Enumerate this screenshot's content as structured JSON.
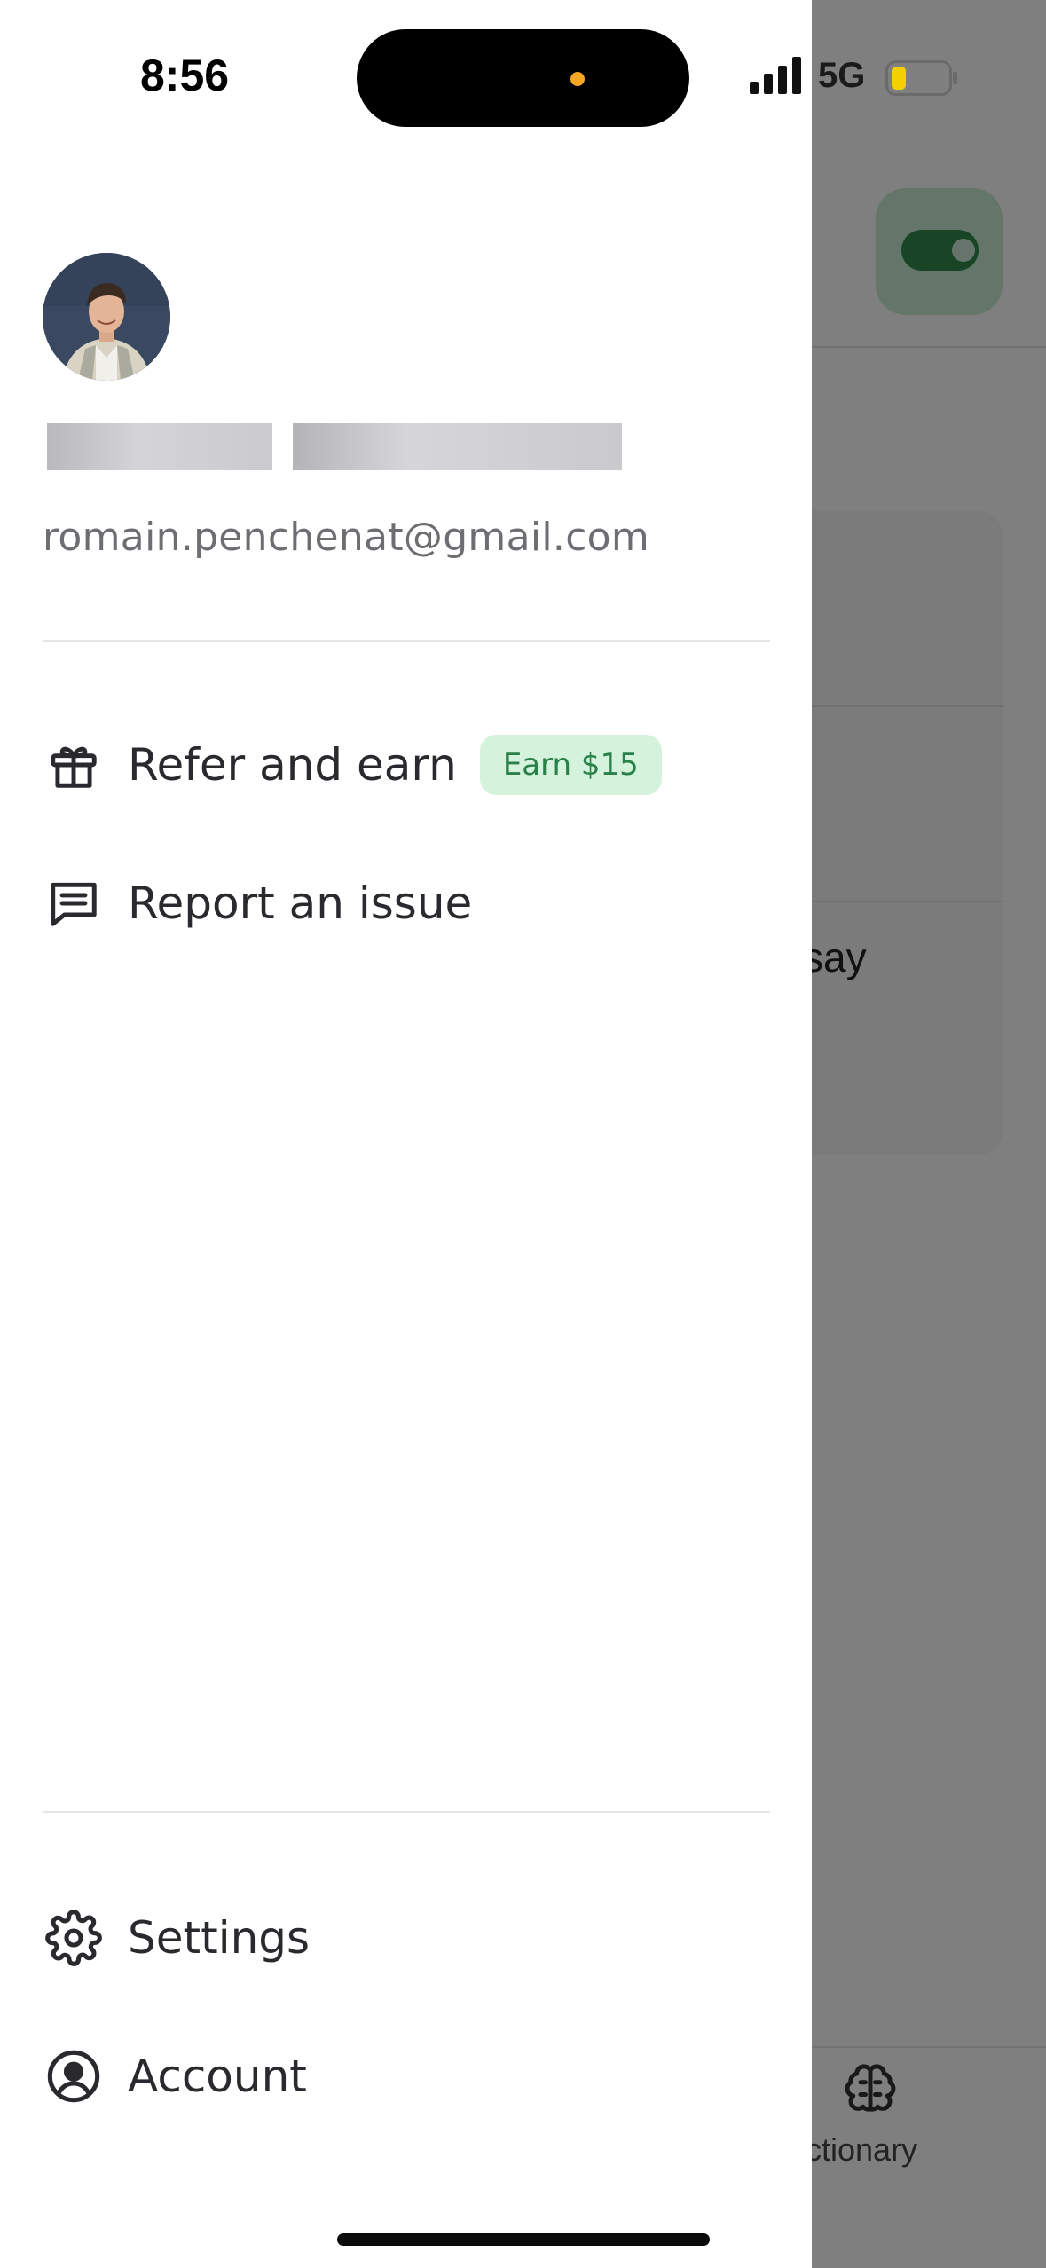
{
  "status_bar": {
    "time": "8:56",
    "network": "5G"
  },
  "profile": {
    "email": "romain.penchenat@gmail.com"
  },
  "menu": {
    "refer": {
      "label": "Refer and earn",
      "badge": "Earn $15",
      "icon": "gift-icon"
    },
    "report": {
      "label": "Report an issue",
      "icon": "message-icon"
    }
  },
  "bottom_menu": {
    "settings": {
      "label": "Settings",
      "icon": "gear-icon"
    },
    "account": {
      "label": "Account",
      "icon": "user-circle-icon"
    }
  },
  "background": {
    "card_text_1": ".",
    "card_text_2": "say",
    "tab_label": "ictionary"
  },
  "colors": {
    "accent_green": "#2a8049",
    "badge_bg": "#d5f2dc"
  }
}
